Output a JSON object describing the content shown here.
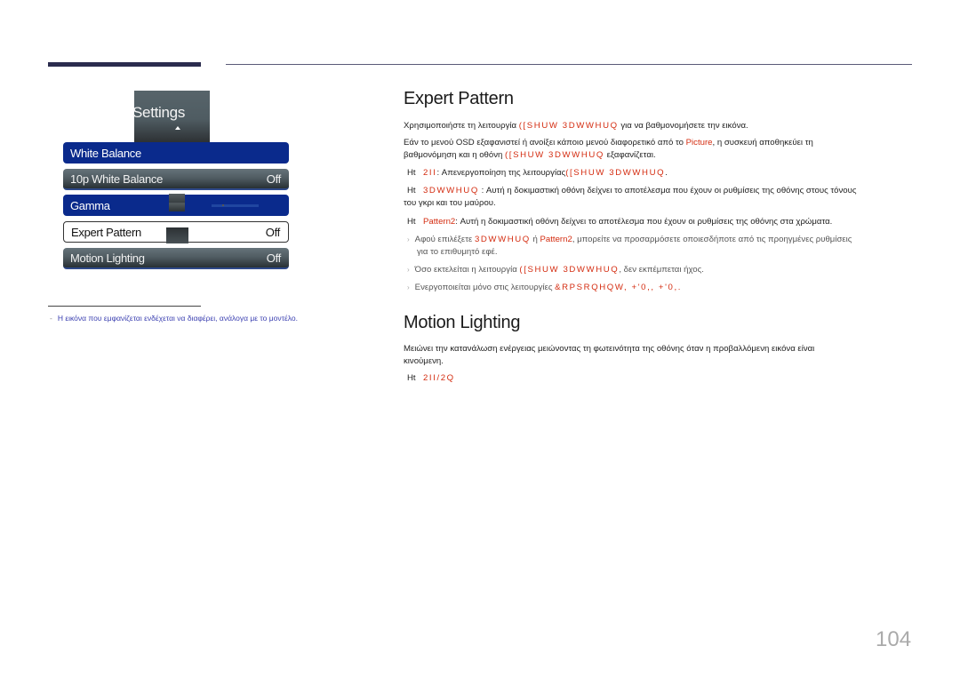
{
  "osd": {
    "title": "Settings",
    "items": [
      {
        "label": "White Balance",
        "value": ""
      },
      {
        "label": "10p White Balance",
        "value": "Off"
      },
      {
        "label": "Gamma",
        "value": ""
      },
      {
        "label": "Expert Pattern",
        "value": "Off"
      },
      {
        "label": "Motion Lighting",
        "value": "Off"
      }
    ]
  },
  "note": {
    "dash": "-",
    "text": "Η εικόνα που εμφανίζεται ενδέχεται να διαφέρει, ανάλογα με το μοντέλο."
  },
  "expert_pattern": {
    "heading": "Expert Pattern",
    "p1_a": "Χρησιμοποιήστε τη λειτουργία ",
    "p1_red": "([SHUW 3DWWHUQ",
    "p1_b": " για να βαθμονομήσετε την εικόνα.",
    "p2_a": "Εάν το μενού OSD εξαφανιστεί ή ανοίξει κάποιο μενού διαφορετικό από το ",
    "p2_red": "Picture",
    "p2_b": ", η συσκευή αποθηκεύει τη",
    "p2_c": "βαθμονόμηση και η οθόνη ",
    "p2_red2": "([SHUW 3DWWHUQ",
    "p2_d": " εξαφανίζεται.",
    "opt_prefix": "Ht",
    "opt1_red": "2II",
    "opt1_text": ": Απενεργοποίηση της λειτουργίας",
    "opt1_red2": "([SHUW 3DWWHUQ",
    "opt1_end": ".",
    "opt2_red": "3DWWHUQ",
    "opt2_text": " : Αυτή η δοκιμαστική οθόνη δείχνει το αποτέλεσμα που έχουν οι ρυθμίσεις της οθόνης στους τόνους",
    "opt2_cont": "του γκρι και του μαύρου.",
    "opt3_red": "Pattern2",
    "opt3_text": ": Αυτή η δοκιμαστική οθόνη δείχνει το αποτέλεσμα που έχουν οι ρυθμίσεις της οθόνης στα χρώματα.",
    "bullet": "›",
    "n1_a": "Αφού επιλέξετε ",
    "n1_red": "3DWWHUQ",
    "n1_b": " ή ",
    "n1_red2": "Pattern2",
    "n1_c": ", μπορείτε να προσαρμόσετε οποιεσδήποτε από τις προηγμένες ρυθμίσεις",
    "n1_cont": "για το επιθυμητό εφέ.",
    "n2_a": "Όσο εκτελείται η λειτουργία ",
    "n2_red": "([SHUW 3DWWHUQ",
    "n2_b": ", δεν εκπέμπεται ήχος.",
    "n3_a": "Ενεργοποιείται μόνο στις λειτουργίες ",
    "n3_red": "&RPSRQHQW, +'0,, +'0,.",
    "n3_b": ""
  },
  "motion_lighting": {
    "heading": "Motion Lighting",
    "p1": "Μειώνει την κατανάλωση ενέργειας μειώνοντας τη φωτεινότητα της οθόνης όταν η προβαλλόμενη εικόνα είναι",
    "p1_cont": "κινούμενη.",
    "opt_prefix": "Ht",
    "opt_red": "2II/2Q"
  },
  "page_number": "104"
}
